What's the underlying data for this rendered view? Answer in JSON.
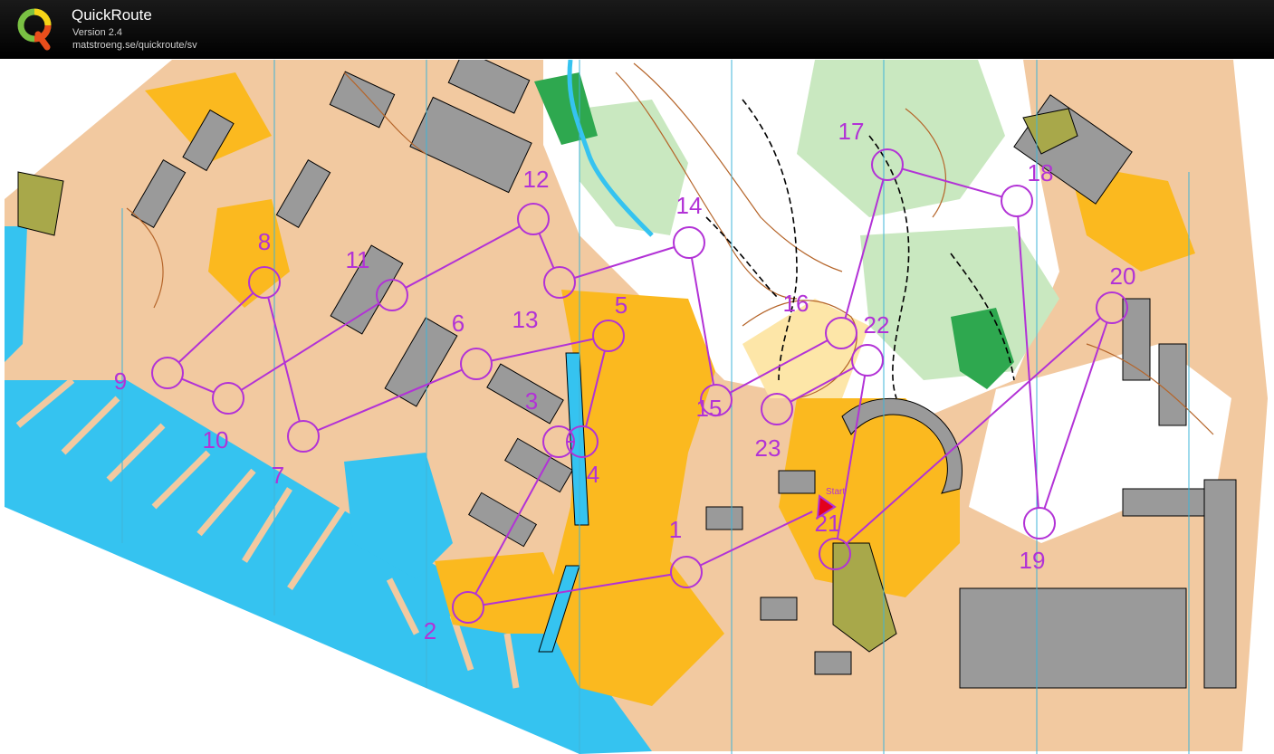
{
  "app": {
    "title": "QuickRoute",
    "version": "Version 2.4",
    "url": "matstroeng.se/quickroute/sv"
  },
  "colors": {
    "course": "#b232d6",
    "open_land": "#fbb91f",
    "rough_open": "#fde6a8",
    "paved": "#f2c9a0",
    "water": "#35c3f0",
    "forest": "#ffffff",
    "green_light": "#c9e8c0",
    "green_dark": "#2ea84f",
    "building": "#9a9a9a",
    "olive": "#a8a84a",
    "contour": "#b5652a",
    "magnetic_line": "#3fb4d8"
  },
  "course": {
    "start": {
      "label": "Start"
    },
    "controls": [
      {
        "number": "1"
      },
      {
        "number": "2"
      },
      {
        "number": "3"
      },
      {
        "number": "4"
      },
      {
        "number": "5"
      },
      {
        "number": "6"
      },
      {
        "number": "7"
      },
      {
        "number": "8"
      },
      {
        "number": "9"
      },
      {
        "number": "10"
      },
      {
        "number": "11"
      },
      {
        "number": "12"
      },
      {
        "number": "13"
      },
      {
        "number": "14"
      },
      {
        "number": "15"
      },
      {
        "number": "16"
      },
      {
        "number": "17"
      },
      {
        "number": "18"
      },
      {
        "number": "19"
      },
      {
        "number": "20"
      },
      {
        "number": "21"
      },
      {
        "number": "22"
      },
      {
        "number": "23"
      }
    ]
  }
}
